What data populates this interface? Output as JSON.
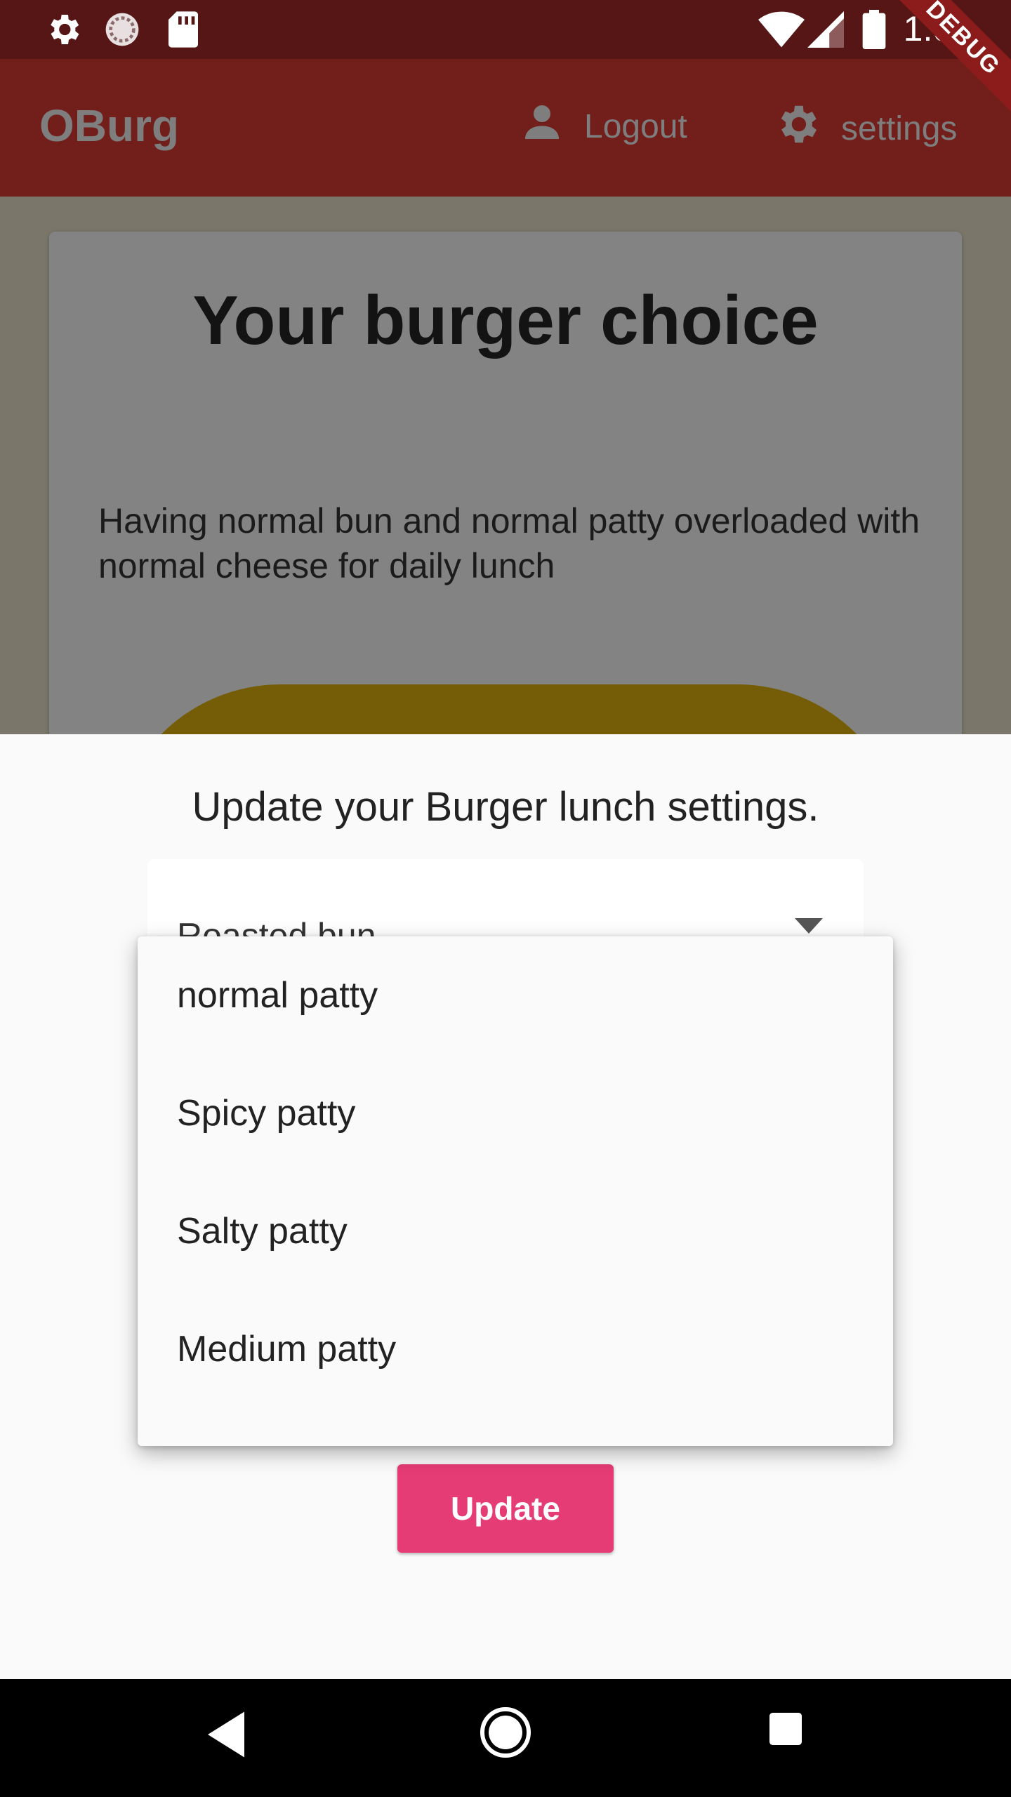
{
  "status_bar": {
    "time": "1:00",
    "icons": [
      "settings-icon",
      "loading-icon",
      "sd-card-icon",
      "wifi-icon",
      "signal-icon",
      "battery-icon"
    ]
  },
  "app_bar": {
    "title": "OBurg",
    "logout_label": "Logout",
    "settings_label": "settings",
    "debug_banner": "DEBUG",
    "background_color": "#721f1c"
  },
  "card": {
    "title": "Your burger choice",
    "description": "Having normal bun  and normal patty overloaded with normal cheese for daily lunch"
  },
  "sheet": {
    "title": "Update your Burger lunch settings.",
    "bun_dropdown_value": "Roasted bun",
    "update_label": "Update",
    "update_color": "#e63c76"
  },
  "patty_menu": {
    "items": [
      "normal patty",
      "Spicy patty",
      "Salty patty",
      "Medium patty"
    ]
  },
  "nav_bar": {
    "icons": [
      "back-icon",
      "home-icon",
      "recents-icon"
    ]
  }
}
